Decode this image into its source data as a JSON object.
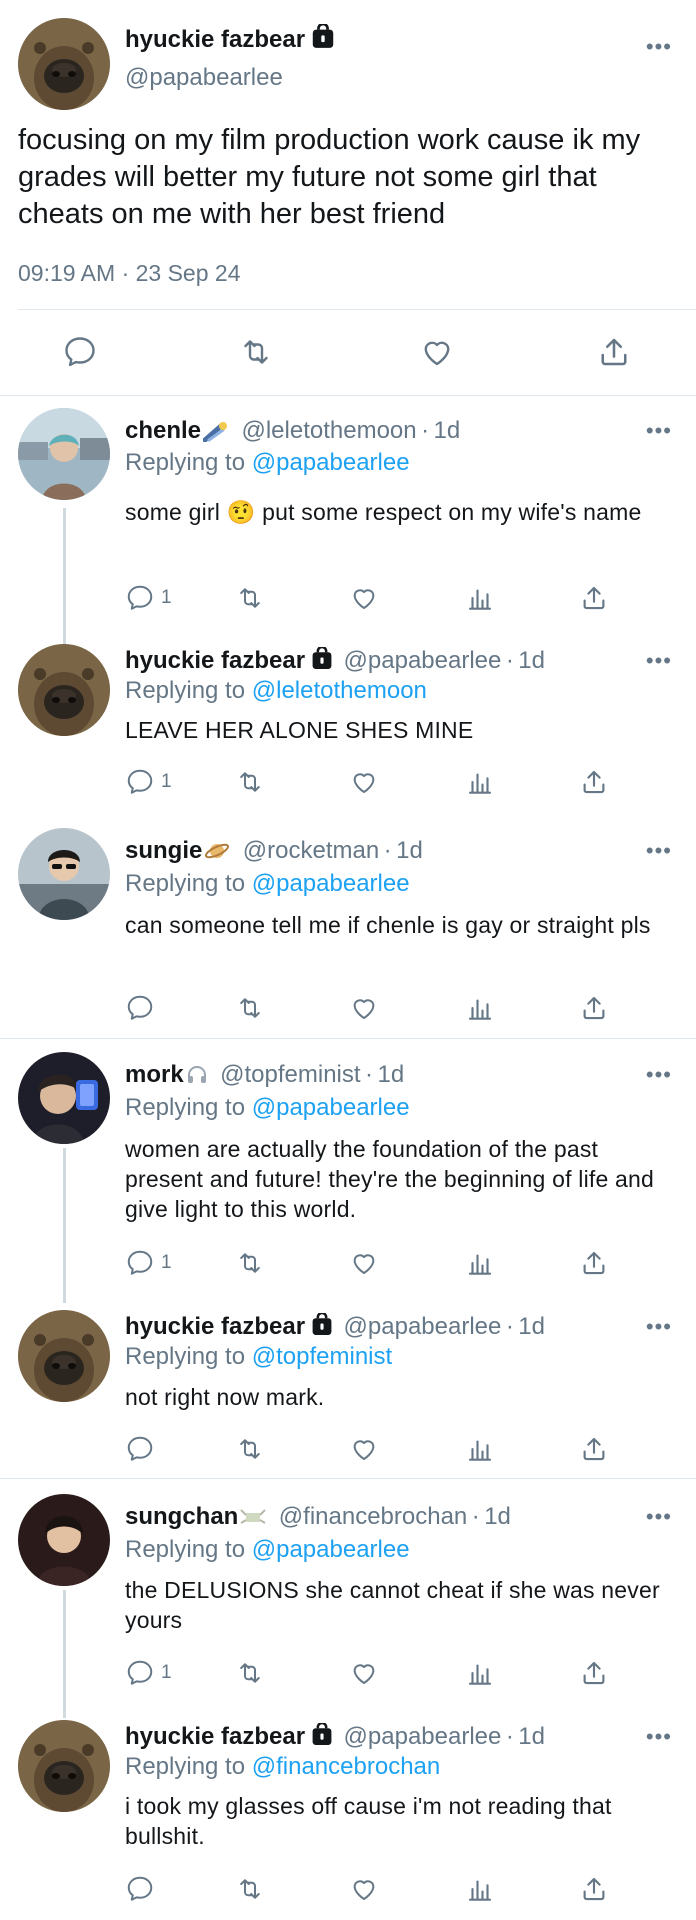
{
  "main_tweet": {
    "display_name": "hyuckie fazbear",
    "handle": "@papabearlee",
    "text": "focusing on my film production work cause ik my grades will better my future not some girl that cheats on me with her best friend",
    "timestamp": "09:19 AM · 23 Sep 24"
  },
  "replies": [
    {
      "display_name": "chenle",
      "emoji": "comet",
      "handle": "@leletothemoon",
      "time": "1d",
      "replying_label": "Replying to",
      "replying_to": "@papabearlee",
      "text": "some girl 🤨  put some respect on my wife's name",
      "reply_count": "1"
    },
    {
      "display_name": "hyuckie fazbear",
      "handle": "@papabearlee",
      "time": "1d",
      "replying_label": "Replying to",
      "replying_to": "@leletothemoon",
      "text": "LEAVE HER ALONE SHES MINE",
      "reply_count": "1"
    },
    {
      "display_name": "sungie",
      "emoji": "planet",
      "handle": "@rocketman",
      "time": "1d",
      "replying_label": "Replying to",
      "replying_to": "@papabearlee",
      "text": "can someone tell me if chenle is gay or straight pls",
      "reply_count": ""
    },
    {
      "display_name": "mork",
      "emoji": "headphones",
      "handle": "@topfeminist",
      "time": "1d",
      "replying_label": "Replying to",
      "replying_to": "@papabearlee",
      "text": "women are actually the foundation of the past present and future! they're the beginning of life and give light to this world.",
      "reply_count": "1"
    },
    {
      "display_name": "hyuckie fazbear",
      "handle": "@papabearlee",
      "time": "1d",
      "replying_label": "Replying to",
      "replying_to": "@topfeminist",
      "text": "not right now mark.",
      "reply_count": ""
    },
    {
      "display_name": "sungchan",
      "emoji": "money-wings",
      "handle": "@financebrochan",
      "time": "1d",
      "replying_label": "Replying to",
      "replying_to": "@papabearlee",
      "text": "the DELUSIONS she cannot cheat if she was never yours",
      "reply_count": "1"
    },
    {
      "display_name": "hyuckie fazbear",
      "handle": "@papabearlee",
      "time": "1d",
      "replying_label": "Replying to",
      "replying_to": "@financebrochan",
      "text": "i took my glasses off cause i'm not reading that bullshit.",
      "reply_count": ""
    }
  ],
  "more_label": "•••",
  "separator": "·",
  "colors": {
    "link": "#1da1f2",
    "muted": "#657786",
    "divider": "#e1e8ed",
    "text": "#14171a"
  }
}
